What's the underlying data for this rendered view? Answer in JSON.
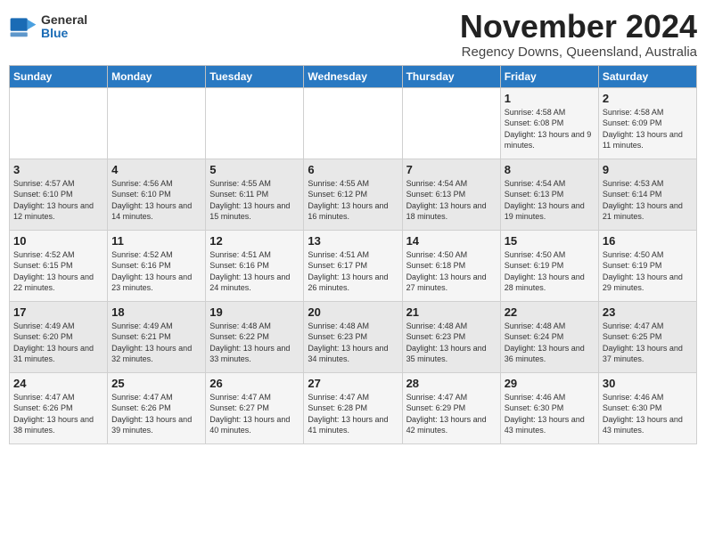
{
  "logo": {
    "general": "General",
    "blue": "Blue"
  },
  "title": "November 2024",
  "subtitle": "Regency Downs, Queensland, Australia",
  "days_header": [
    "Sunday",
    "Monday",
    "Tuesday",
    "Wednesday",
    "Thursday",
    "Friday",
    "Saturday"
  ],
  "weeks": [
    [
      {
        "day": "",
        "content": ""
      },
      {
        "day": "",
        "content": ""
      },
      {
        "day": "",
        "content": ""
      },
      {
        "day": "",
        "content": ""
      },
      {
        "day": "",
        "content": ""
      },
      {
        "day": "1",
        "content": "Sunrise: 4:58 AM\nSunset: 6:08 PM\nDaylight: 13 hours and 9 minutes."
      },
      {
        "day": "2",
        "content": "Sunrise: 4:58 AM\nSunset: 6:09 PM\nDaylight: 13 hours and 11 minutes."
      }
    ],
    [
      {
        "day": "3",
        "content": "Sunrise: 4:57 AM\nSunset: 6:10 PM\nDaylight: 13 hours and 12 minutes."
      },
      {
        "day": "4",
        "content": "Sunrise: 4:56 AM\nSunset: 6:10 PM\nDaylight: 13 hours and 14 minutes."
      },
      {
        "day": "5",
        "content": "Sunrise: 4:55 AM\nSunset: 6:11 PM\nDaylight: 13 hours and 15 minutes."
      },
      {
        "day": "6",
        "content": "Sunrise: 4:55 AM\nSunset: 6:12 PM\nDaylight: 13 hours and 16 minutes."
      },
      {
        "day": "7",
        "content": "Sunrise: 4:54 AM\nSunset: 6:13 PM\nDaylight: 13 hours and 18 minutes."
      },
      {
        "day": "8",
        "content": "Sunrise: 4:54 AM\nSunset: 6:13 PM\nDaylight: 13 hours and 19 minutes."
      },
      {
        "day": "9",
        "content": "Sunrise: 4:53 AM\nSunset: 6:14 PM\nDaylight: 13 hours and 21 minutes."
      }
    ],
    [
      {
        "day": "10",
        "content": "Sunrise: 4:52 AM\nSunset: 6:15 PM\nDaylight: 13 hours and 22 minutes."
      },
      {
        "day": "11",
        "content": "Sunrise: 4:52 AM\nSunset: 6:16 PM\nDaylight: 13 hours and 23 minutes."
      },
      {
        "day": "12",
        "content": "Sunrise: 4:51 AM\nSunset: 6:16 PM\nDaylight: 13 hours and 24 minutes."
      },
      {
        "day": "13",
        "content": "Sunrise: 4:51 AM\nSunset: 6:17 PM\nDaylight: 13 hours and 26 minutes."
      },
      {
        "day": "14",
        "content": "Sunrise: 4:50 AM\nSunset: 6:18 PM\nDaylight: 13 hours and 27 minutes."
      },
      {
        "day": "15",
        "content": "Sunrise: 4:50 AM\nSunset: 6:19 PM\nDaylight: 13 hours and 28 minutes."
      },
      {
        "day": "16",
        "content": "Sunrise: 4:50 AM\nSunset: 6:19 PM\nDaylight: 13 hours and 29 minutes."
      }
    ],
    [
      {
        "day": "17",
        "content": "Sunrise: 4:49 AM\nSunset: 6:20 PM\nDaylight: 13 hours and 31 minutes."
      },
      {
        "day": "18",
        "content": "Sunrise: 4:49 AM\nSunset: 6:21 PM\nDaylight: 13 hours and 32 minutes."
      },
      {
        "day": "19",
        "content": "Sunrise: 4:48 AM\nSunset: 6:22 PM\nDaylight: 13 hours and 33 minutes."
      },
      {
        "day": "20",
        "content": "Sunrise: 4:48 AM\nSunset: 6:23 PM\nDaylight: 13 hours and 34 minutes."
      },
      {
        "day": "21",
        "content": "Sunrise: 4:48 AM\nSunset: 6:23 PM\nDaylight: 13 hours and 35 minutes."
      },
      {
        "day": "22",
        "content": "Sunrise: 4:48 AM\nSunset: 6:24 PM\nDaylight: 13 hours and 36 minutes."
      },
      {
        "day": "23",
        "content": "Sunrise: 4:47 AM\nSunset: 6:25 PM\nDaylight: 13 hours and 37 minutes."
      }
    ],
    [
      {
        "day": "24",
        "content": "Sunrise: 4:47 AM\nSunset: 6:26 PM\nDaylight: 13 hours and 38 minutes."
      },
      {
        "day": "25",
        "content": "Sunrise: 4:47 AM\nSunset: 6:26 PM\nDaylight: 13 hours and 39 minutes."
      },
      {
        "day": "26",
        "content": "Sunrise: 4:47 AM\nSunset: 6:27 PM\nDaylight: 13 hours and 40 minutes."
      },
      {
        "day": "27",
        "content": "Sunrise: 4:47 AM\nSunset: 6:28 PM\nDaylight: 13 hours and 41 minutes."
      },
      {
        "day": "28",
        "content": "Sunrise: 4:47 AM\nSunset: 6:29 PM\nDaylight: 13 hours and 42 minutes."
      },
      {
        "day": "29",
        "content": "Sunrise: 4:46 AM\nSunset: 6:30 PM\nDaylight: 13 hours and 43 minutes."
      },
      {
        "day": "30",
        "content": "Sunrise: 4:46 AM\nSunset: 6:30 PM\nDaylight: 13 hours and 43 minutes."
      }
    ]
  ]
}
